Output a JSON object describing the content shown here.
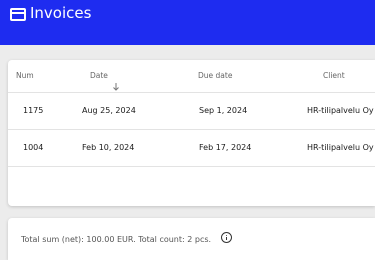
{
  "header": {
    "title": "Invoices",
    "icon": "credit-card-icon",
    "color": "#1e2cf0"
  },
  "table": {
    "columns": {
      "num": "Num",
      "date": "Date",
      "due": "Due date",
      "client": "Client"
    },
    "sort_indicator": "arrow-down-icon",
    "rows": [
      {
        "num": "1175",
        "date": "Aug 25, 2024",
        "due": "Sep 1, 2024",
        "client": "HR-tilipalvelu Oy"
      },
      {
        "num": "1004",
        "date": "Feb 10, 2024",
        "due": "Feb 17, 2024",
        "client": "HR-tilipalvelu Oy"
      }
    ]
  },
  "footer": {
    "summary": "Total sum (net): 100.00 EUR. Total count: 2 pcs.",
    "info_icon": "info-icon"
  }
}
